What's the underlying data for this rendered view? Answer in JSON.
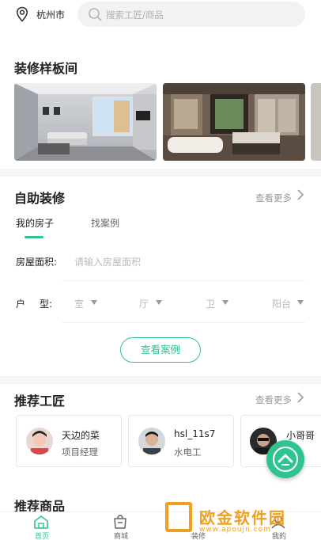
{
  "header": {
    "city": "杭州市",
    "search_placeholder": "搜索工匠/商品"
  },
  "gallery": {
    "title": "装修样板间"
  },
  "diy": {
    "title": "自助装修",
    "more": "查看更多",
    "tabs": [
      "我的房子",
      "找案例"
    ],
    "area_label": "房屋面积:",
    "area_placeholder": "请输入房屋面积",
    "layout_label_1": "户",
    "layout_label_2": "型:",
    "selects": [
      "室",
      "厅",
      "卫",
      "阳台"
    ],
    "view_button": "查看案例"
  },
  "craftsmen": {
    "title": "推荐工匠",
    "more": "查看更多",
    "items": [
      {
        "name": "天边的菜",
        "role": "项目经理"
      },
      {
        "name": "hsl_11s7",
        "role": "水电工"
      },
      {
        "name": "小哥哥",
        "role": ""
      }
    ]
  },
  "products": {
    "title": "推荐商品"
  },
  "nav": {
    "items": [
      "首页",
      "商城",
      "装修",
      "我的"
    ]
  },
  "watermark": {
    "text": "欧金软件园",
    "sub": "www.apoujn.com"
  },
  "colors": {
    "accent": "#2fc48f"
  }
}
